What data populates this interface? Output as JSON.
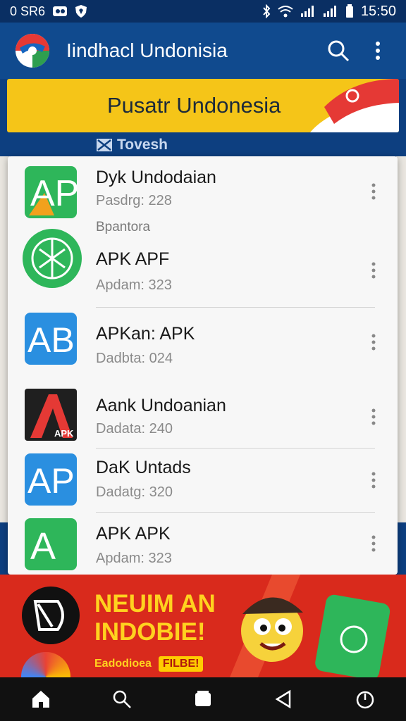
{
  "status_bar": {
    "left_text": "0 SR6",
    "time": "15:50",
    "icons": [
      "notification-icon",
      "shield-icon",
      "bluetooth-icon",
      "wifi-icon",
      "signal-icon",
      "battery-icon"
    ]
  },
  "app_bar": {
    "title": "Iindhacl Undonisia",
    "icons": [
      "search-icon",
      "more-vert-icon"
    ]
  },
  "promo": {
    "text": "Pusatr Undonesia"
  },
  "section": {
    "label": "Tovesh"
  },
  "apps": [
    {
      "name": "Dyk Undodaian",
      "subtitle": "Pasdrg: 228",
      "icon_letter": "AP",
      "icon_color": "#2eb65a"
    },
    {
      "group_label": "Bpantora"
    },
    {
      "name": "APK APF",
      "subtitle": "Apdam: 323",
      "icon_color": "#2eb65a"
    },
    {
      "name": "APKan: APK",
      "subtitle": "Dadbta: 024",
      "icon_letter": "AB",
      "icon_color": "#2a8fe0"
    },
    {
      "name": "Aank Undoanian",
      "subtitle": "Dadata: 240",
      "icon_letter": "A",
      "icon_color": "#1f1f1f",
      "icon_caption": "APK"
    },
    {
      "name": "DaK Untads",
      "subtitle": "Dadatg: 320",
      "icon_letter": "AP",
      "icon_color": "#2a8fe0"
    },
    {
      "name": "APK APK",
      "subtitle": "Apdam: 323",
      "icon_letter": "A",
      "icon_color": "#2eb65a"
    }
  ],
  "ad": {
    "headline_1": "NEUIM AN",
    "headline_2": "INDOBIE!",
    "caption": "Eadodioea",
    "chip": "FILBE!"
  },
  "nav_bar": {
    "icons": [
      "home-icon",
      "search-icon",
      "recents-icon",
      "back-icon",
      "power-icon"
    ]
  },
  "colors": {
    "primary": "#104a8e",
    "status": "#0a2f63",
    "promo": "#f5c518",
    "ad": "#d92a1c",
    "green": "#2eb65a",
    "blue": "#2a8fe0"
  }
}
